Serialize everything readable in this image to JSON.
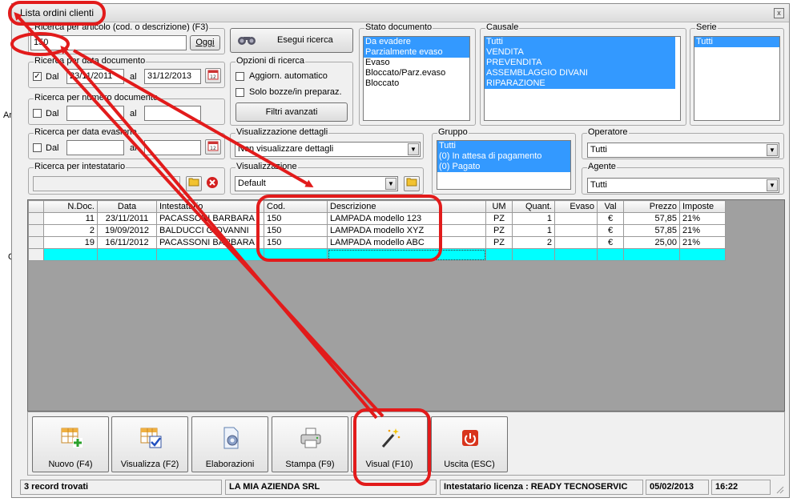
{
  "window": {
    "title": "Lista ordini clienti",
    "close": "x"
  },
  "side_text": {
    "a": "Ar",
    "b": "O"
  },
  "ricerca_articolo": {
    "legend": "Ricerca per articolo (cod. o descrizione) (F3)",
    "value": "150",
    "oggi": "Oggi"
  },
  "esegui": {
    "label": "Esegui ricerca"
  },
  "data_documento": {
    "legend": "Ricerca per data documento",
    "dal": "Dal",
    "checked": true,
    "from": "23/11/2011",
    "al": "al",
    "to": "31/12/2013"
  },
  "numero_documento": {
    "legend": "Ricerca per numero documento",
    "dal": "Dal",
    "al": "al"
  },
  "data_evasione": {
    "legend": "Ricerca per data evasione",
    "dal": "Dal",
    "al": "al"
  },
  "intestatario": {
    "legend": "Ricerca per intestatario"
  },
  "opzioni": {
    "legend": "Opzioni di ricerca",
    "aggiorn": "Aggiorn. automatico",
    "bozze": "Solo bozze/in preparaz.",
    "filtri": "Filtri avanzati"
  },
  "vis_dettagli": {
    "legend": "Visualizzazione dettagli",
    "value": "Non visualizzare dettagli"
  },
  "visualizzazione": {
    "legend": "Visualizzazione",
    "value": "Default"
  },
  "stato": {
    "legend": "Stato documento",
    "items": [
      {
        "label": "Da evadere",
        "sel": true
      },
      {
        "label": "Parzialmente evaso",
        "sel": true
      },
      {
        "label": "Evaso",
        "sel": false
      },
      {
        "label": "Bloccato/Parz.evaso",
        "sel": false
      },
      {
        "label": "Bloccato",
        "sel": false
      }
    ]
  },
  "causale": {
    "legend": "Causale",
    "items": [
      {
        "label": "Tutti",
        "sel": true
      },
      {
        "label": "VENDITA",
        "sel": true
      },
      {
        "label": "PREVENDITA",
        "sel": true
      },
      {
        "label": "ASSEMBLAGGIO DIVANI",
        "sel": true
      },
      {
        "label": "RIPARAZIONE",
        "sel": true
      }
    ]
  },
  "serie": {
    "legend": "Serie",
    "items": [
      {
        "label": "Tutti",
        "sel": true
      }
    ]
  },
  "gruppo": {
    "legend": "Gruppo",
    "items": [
      {
        "label": "Tutti",
        "sel": true
      },
      {
        "label": "(0) In attesa di pagamento",
        "sel": true
      },
      {
        "label": "(0) Pagato",
        "sel": true
      }
    ]
  },
  "operatore": {
    "legend": "Operatore",
    "value": "Tutti"
  },
  "agente": {
    "legend": "Agente",
    "value": "Tutti"
  },
  "grid": {
    "headers": [
      "N.Doc.",
      "Data",
      "Intestatario",
      "Cod.",
      "Descrizione",
      "UM",
      "Quant.",
      "Evaso",
      "Val",
      "Prezzo",
      "Imposte"
    ],
    "rows": [
      [
        "11",
        "23/11/2011",
        "PACASSONI BARBARA",
        "150",
        "LAMPADA modello 123",
        "PZ",
        "1",
        "",
        "€",
        "57,85",
        "21%"
      ],
      [
        "2",
        "19/09/2012",
        "BALDUCCI GIOVANNI",
        "150",
        "LAMPADA modello XYZ",
        "PZ",
        "1",
        "",
        "€",
        "57,85",
        "21%"
      ],
      [
        "19",
        "16/11/2012",
        "PACASSONI BARBARA",
        "150",
        "LAMPADA modello ABC",
        "PZ",
        "2",
        "",
        "€",
        "25,00",
        "21%"
      ]
    ]
  },
  "toolbar": {
    "buttons": [
      {
        "label": "Nuovo (F4)",
        "icon": "grid-add-icon"
      },
      {
        "label": "Visualizza (F2)",
        "icon": "grid-check-icon"
      },
      {
        "label": "Elaborazioni",
        "icon": "document-gear-icon"
      },
      {
        "label": "Stampa (F9)",
        "icon": "printer-icon"
      },
      {
        "label": "Visual (F10)",
        "icon": "magic-wand-icon"
      },
      {
        "label": "Uscita (ESC)",
        "icon": "power-icon"
      }
    ]
  },
  "status": {
    "records": "3 record trovati",
    "company": "LA MIA AZIENDA SRL",
    "license": "Intestatario licenza : READY TECNOSERVIC",
    "date": "05/02/2013",
    "time": "16:22"
  },
  "colors": {
    "selection": "#3399ff",
    "new_row": "#00ffff",
    "annotation": "#e21b1b"
  }
}
